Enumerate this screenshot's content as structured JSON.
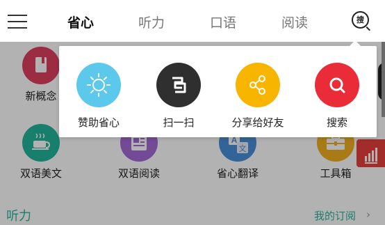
{
  "header": {
    "tabs": [
      {
        "label": "省心",
        "active": true
      },
      {
        "label": "听力",
        "active": false
      },
      {
        "label": "口语",
        "active": false
      },
      {
        "label": "阅读",
        "active": false
      }
    ],
    "search_icon_char": "搜"
  },
  "grid": {
    "row1": [
      {
        "label": "新概念",
        "icon": "book-icon",
        "color": "#e0405e"
      }
    ],
    "row2": [
      {
        "label": "双语美文",
        "icon": "coffee-cup-icon",
        "color": "#22b79a"
      },
      {
        "label": "双语阅读",
        "icon": "newspaper-icon",
        "color": "#a56bd6"
      },
      {
        "label": "省心翻译",
        "icon": "translate-icon",
        "color": "#4a90d9"
      },
      {
        "label": "工具箱",
        "icon": "toolbox-icon",
        "color": "#f2b022"
      }
    ]
  },
  "section": {
    "title": "听力",
    "link": "我的订阅",
    "chevron": "›"
  },
  "popup": {
    "items": [
      {
        "label": "赞助省心",
        "icon": "sun-icon",
        "color": "#5bc8ec"
      },
      {
        "label": "扫一扫",
        "icon": "scan-icon",
        "color": "#2f2f2f"
      },
      {
        "label": "分享给好友",
        "icon": "share-icon",
        "color": "#f7b500"
      },
      {
        "label": "搜索",
        "icon": "search-icon",
        "color": "#ea2c38"
      }
    ]
  },
  "colors": {
    "accent": "#2bb3a0",
    "fab": "#e8403b"
  }
}
